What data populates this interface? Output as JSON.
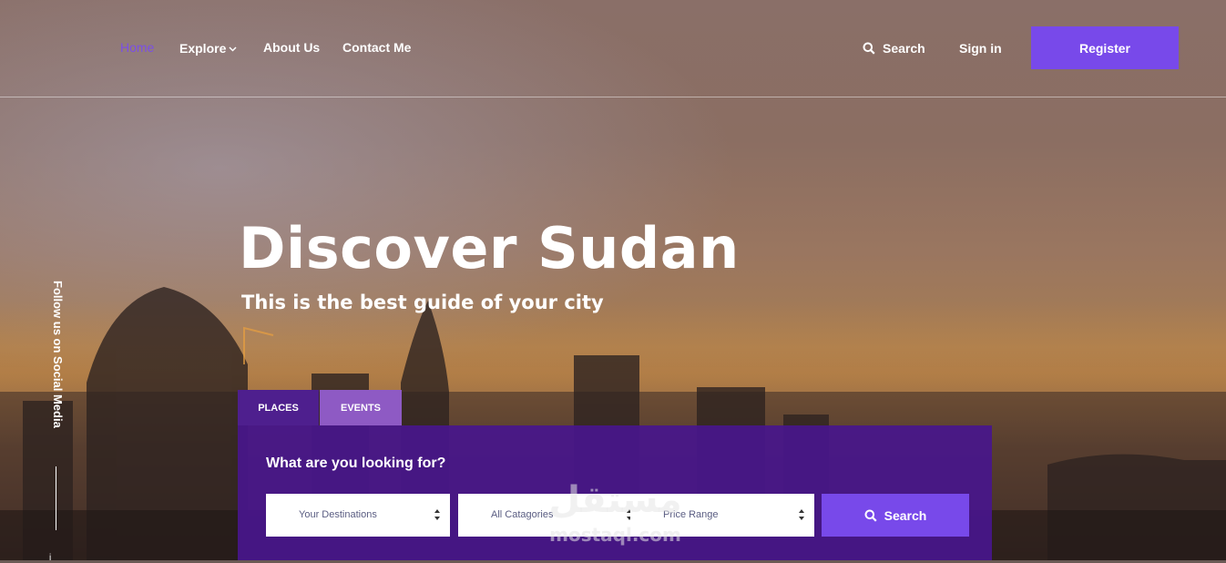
{
  "nav": {
    "links": [
      {
        "label": "Home",
        "active": true
      },
      {
        "label": "Explore",
        "has_dropdown": true
      },
      {
        "label": "About Us"
      },
      {
        "label": "Contact Me"
      }
    ],
    "search_label": "Search",
    "signin_label": "Sign in",
    "register_label": "Register"
  },
  "social": {
    "follow_text": "Follow us on Social Media"
  },
  "hero": {
    "title": "Discover Sudan",
    "subtitle": "This is the best guide of your city"
  },
  "tabs": [
    {
      "label": "PLACES",
      "active": true
    },
    {
      "label": "EVENTS",
      "active": false
    }
  ],
  "search_panel": {
    "question": "What are you looking for?",
    "selects": [
      {
        "value": "Your Destinations"
      },
      {
        "value": "All Catagories"
      },
      {
        "value": "Price Range"
      }
    ],
    "button_label": "Search"
  },
  "watermark": {
    "arabic": "مستقل",
    "latin": "mostaql.com"
  },
  "colors": {
    "accent": "#7849ea",
    "active_link": "#7b4fe6",
    "panel": "#48168c",
    "tab_active": "#4e1f8e",
    "tab_inactive": "#8e5ac4"
  }
}
